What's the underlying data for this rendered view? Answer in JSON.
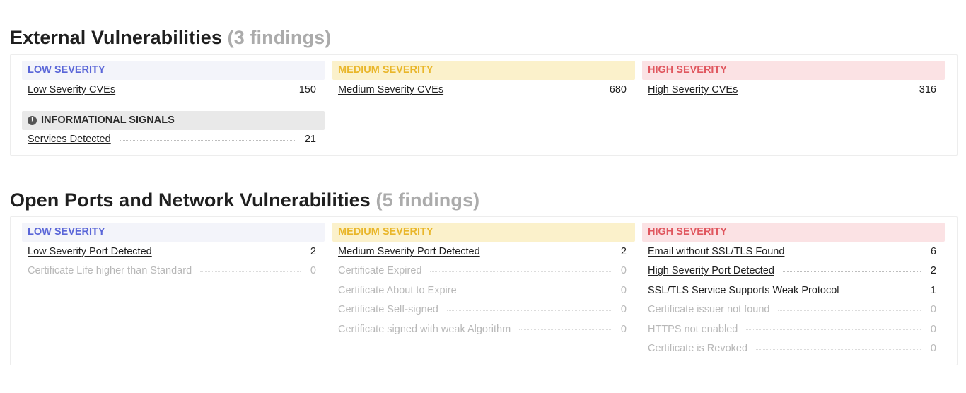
{
  "external": {
    "title": "External Vulnerabilities",
    "count": "(3 findings)",
    "low": {
      "header": "LOW SEVERITY",
      "rows": [
        {
          "label": "Low Severity CVEs",
          "value": "150"
        }
      ]
    },
    "info": {
      "icon": "exclamation-icon",
      "header": "INFORMATIONAL SIGNALS",
      "rows": [
        {
          "label": "Services Detected",
          "value": "21"
        }
      ]
    },
    "medium": {
      "header": "MEDIUM SEVERITY",
      "rows": [
        {
          "label": "Medium Severity CVEs",
          "value": "680"
        }
      ]
    },
    "high": {
      "header": "HIGH SEVERITY",
      "rows": [
        {
          "label": "High Severity CVEs",
          "value": "316"
        }
      ]
    }
  },
  "ports": {
    "title": "Open Ports and Network Vulnerabilities",
    "count": "(5 findings)",
    "low": {
      "header": "LOW SEVERITY",
      "rows": [
        {
          "label": "Low Severity Port Detected",
          "value": "2"
        },
        {
          "label": "Certificate Life higher than Standard",
          "value": "0"
        }
      ]
    },
    "medium": {
      "header": "MEDIUM SEVERITY",
      "rows": [
        {
          "label": "Medium Severity Port Detected",
          "value": "2"
        },
        {
          "label": "Certificate Expired",
          "value": "0"
        },
        {
          "label": "Certificate About to Expire",
          "value": "0"
        },
        {
          "label": "Certificate Self-signed",
          "value": "0"
        },
        {
          "label": "Certificate signed with weak Algorithm",
          "value": "0"
        }
      ]
    },
    "high": {
      "header": "HIGH SEVERITY",
      "rows": [
        {
          "label": "Email without SSL/TLS Found",
          "value": "6"
        },
        {
          "label": "High Severity Port Detected",
          "value": "2"
        },
        {
          "label": "SSL/TLS Service Supports Weak Protocol",
          "value": "1"
        },
        {
          "label": "Certificate issuer not found",
          "value": "0"
        },
        {
          "label": "HTTPS not enabled",
          "value": "0"
        },
        {
          "label": "Certificate is Revoked",
          "value": "0"
        }
      ]
    }
  },
  "colors": {
    "low": "#5a66d8",
    "medium": "#e9b62a",
    "high": "#e0575f",
    "low_bg": "#f3f4fa",
    "medium_bg": "#fbf1cb",
    "high_bg": "#fbe2e4"
  }
}
